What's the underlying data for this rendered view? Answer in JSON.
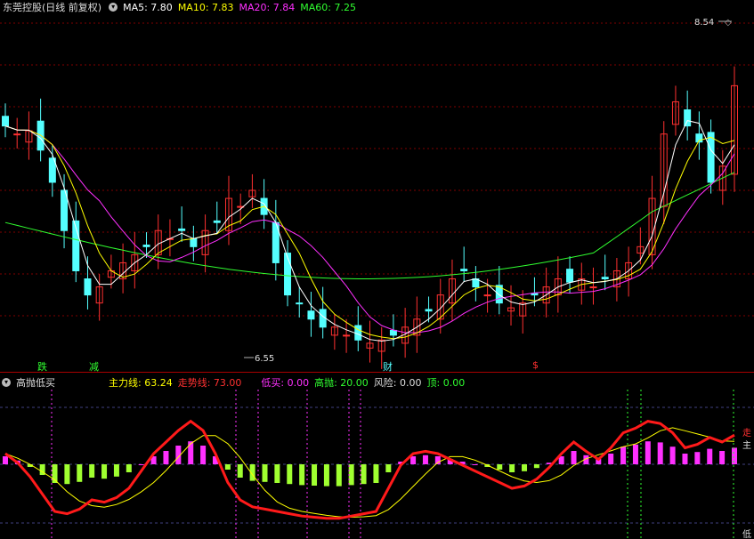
{
  "top": {
    "title": "东莞控股(日线 前复权)",
    "ma5": "MA5: 7.80",
    "ma10": "MA10: 7.83",
    "ma20": "MA20: 7.84",
    "ma60": "MA60: 7.25",
    "high_label": "8.54",
    "low_label": "6.55"
  },
  "markers": {
    "die": "跌",
    "jian": "减",
    "cai": "财",
    "dollar": "$"
  },
  "indicator": {
    "title": "高抛低买",
    "main_line": "主力线: 63.24",
    "trend_line": "走势线: 73.00",
    "low_buy": "低买: 0.00",
    "high_sell": "高抛: 20.00",
    "risk": "风险: 0.00",
    "top": "顶: 0.00",
    "right_label_1": "走",
    "right_label_2": "主",
    "right_label_3": "低"
  },
  "colors": {
    "up": "#ff3030",
    "down": "#54ffff",
    "ma5": "#ffffff",
    "ma10": "#ffff00",
    "ma20": "#ff30ff",
    "ma60": "#30ff30"
  },
  "chart_data": {
    "type": "candlestick",
    "title": "东莞控股(日线 前复权)",
    "high": 8.54,
    "low": 6.55,
    "ma": [
      {
        "name": "MA5",
        "value": 7.8
      },
      {
        "name": "MA10",
        "value": 7.83
      },
      {
        "name": "MA20",
        "value": 7.84
      },
      {
        "name": "MA60",
        "value": 7.25
      }
    ],
    "close_series_approx": [
      7.95,
      7.9,
      7.92,
      7.8,
      7.6,
      7.3,
      7.05,
      6.9,
      6.95,
      7.05,
      7.1,
      7.15,
      7.2,
      7.3,
      7.25,
      7.3,
      7.2,
      7.3,
      7.35,
      7.5,
      7.45,
      7.55,
      7.4,
      7.1,
      6.9,
      6.85,
      6.75,
      6.7,
      6.7,
      6.65,
      6.62,
      6.6,
      6.62,
      6.65,
      6.7,
      6.75,
      6.8,
      6.9,
      7.0,
      7.05,
      6.95,
      6.9,
      6.85,
      6.82,
      6.85,
      6.9,
      6.95,
      7.0,
      6.98,
      7.0,
      6.95,
      7.0,
      7.05,
      7.1,
      7.2,
      7.5,
      7.9,
      8.1,
      7.95,
      7.85,
      7.6,
      7.7,
      8.2
    ],
    "indicator": {
      "name": "高抛低买",
      "series": [
        {
          "name": "主力线",
          "value": 63.24
        },
        {
          "name": "走势线",
          "value": 73.0
        },
        {
          "name": "低买",
          "value": 0.0
        },
        {
          "name": "高抛",
          "value": 20.0
        },
        {
          "name": "风险",
          "value": 0.0
        },
        {
          "name": "顶",
          "value": 0.0
        }
      ],
      "main_series_approx": [
        60,
        52,
        40,
        25,
        10,
        8,
        12,
        20,
        18,
        22,
        30,
        45,
        60,
        70,
        80,
        88,
        80,
        60,
        35,
        20,
        14,
        12,
        10,
        8,
        6,
        5,
        4,
        4,
        6,
        8,
        10,
        30,
        50,
        60,
        62,
        60,
        55,
        50,
        45,
        40,
        35,
        30,
        32,
        38,
        48,
        60,
        70,
        62,
        55,
        65,
        78,
        82,
        88,
        86,
        78,
        65,
        68,
        74,
        70,
        76
      ]
    }
  }
}
